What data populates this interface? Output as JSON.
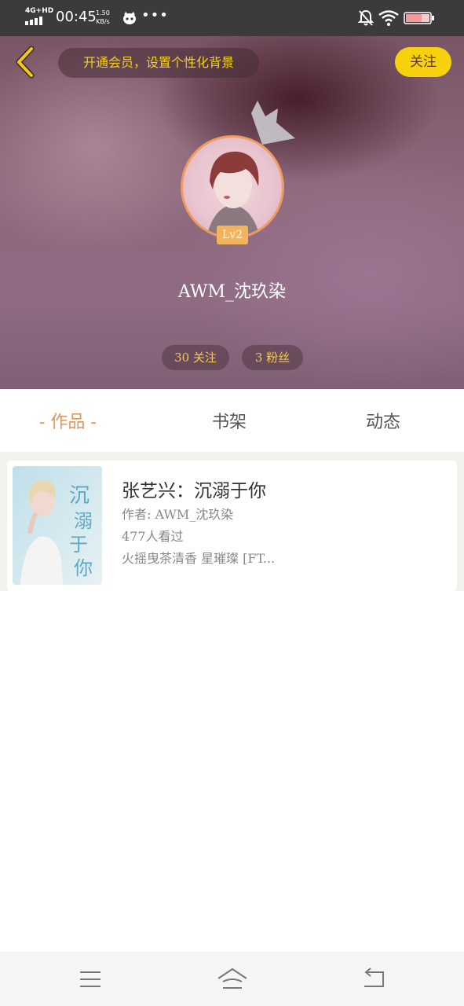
{
  "status_bar": {
    "network": "4G+HD",
    "time": "00:45",
    "speed_value": "1.50",
    "speed_unit": "KB/s",
    "more": "•••",
    "icons": [
      "signal-icon",
      "app-notification-icon",
      "bell-muted-icon",
      "wifi-icon",
      "battery-icon"
    ]
  },
  "header": {
    "back_icon": "chevron-left-icon",
    "vip_prompt": "开通会员，设置个性化背景",
    "follow_label": "关注",
    "crown_icon": "crown-icon",
    "level": "Lv2",
    "username": "AWM_沈玖染",
    "following": "30 关注",
    "fans": "3 粉丝"
  },
  "tabs": {
    "works": "- 作品 -",
    "bookshelf": "书架",
    "activity": "动态",
    "active": "works"
  },
  "books": [
    {
      "title": "张艺兴：沉溺于你",
      "author": "作者: AWM_沈玖染",
      "views": "477人看过",
      "tags": "火摇曳茶清香 星璀璨 [FT...",
      "cover_text": "沉溺于你"
    }
  ],
  "nav_bar": {
    "icons": [
      "menu-icon",
      "home-icon",
      "back-icon"
    ]
  },
  "colors": {
    "accent_yellow": "#f8d10d",
    "accent_orange": "#e8955a",
    "status_bar": "#3b3b3b"
  }
}
